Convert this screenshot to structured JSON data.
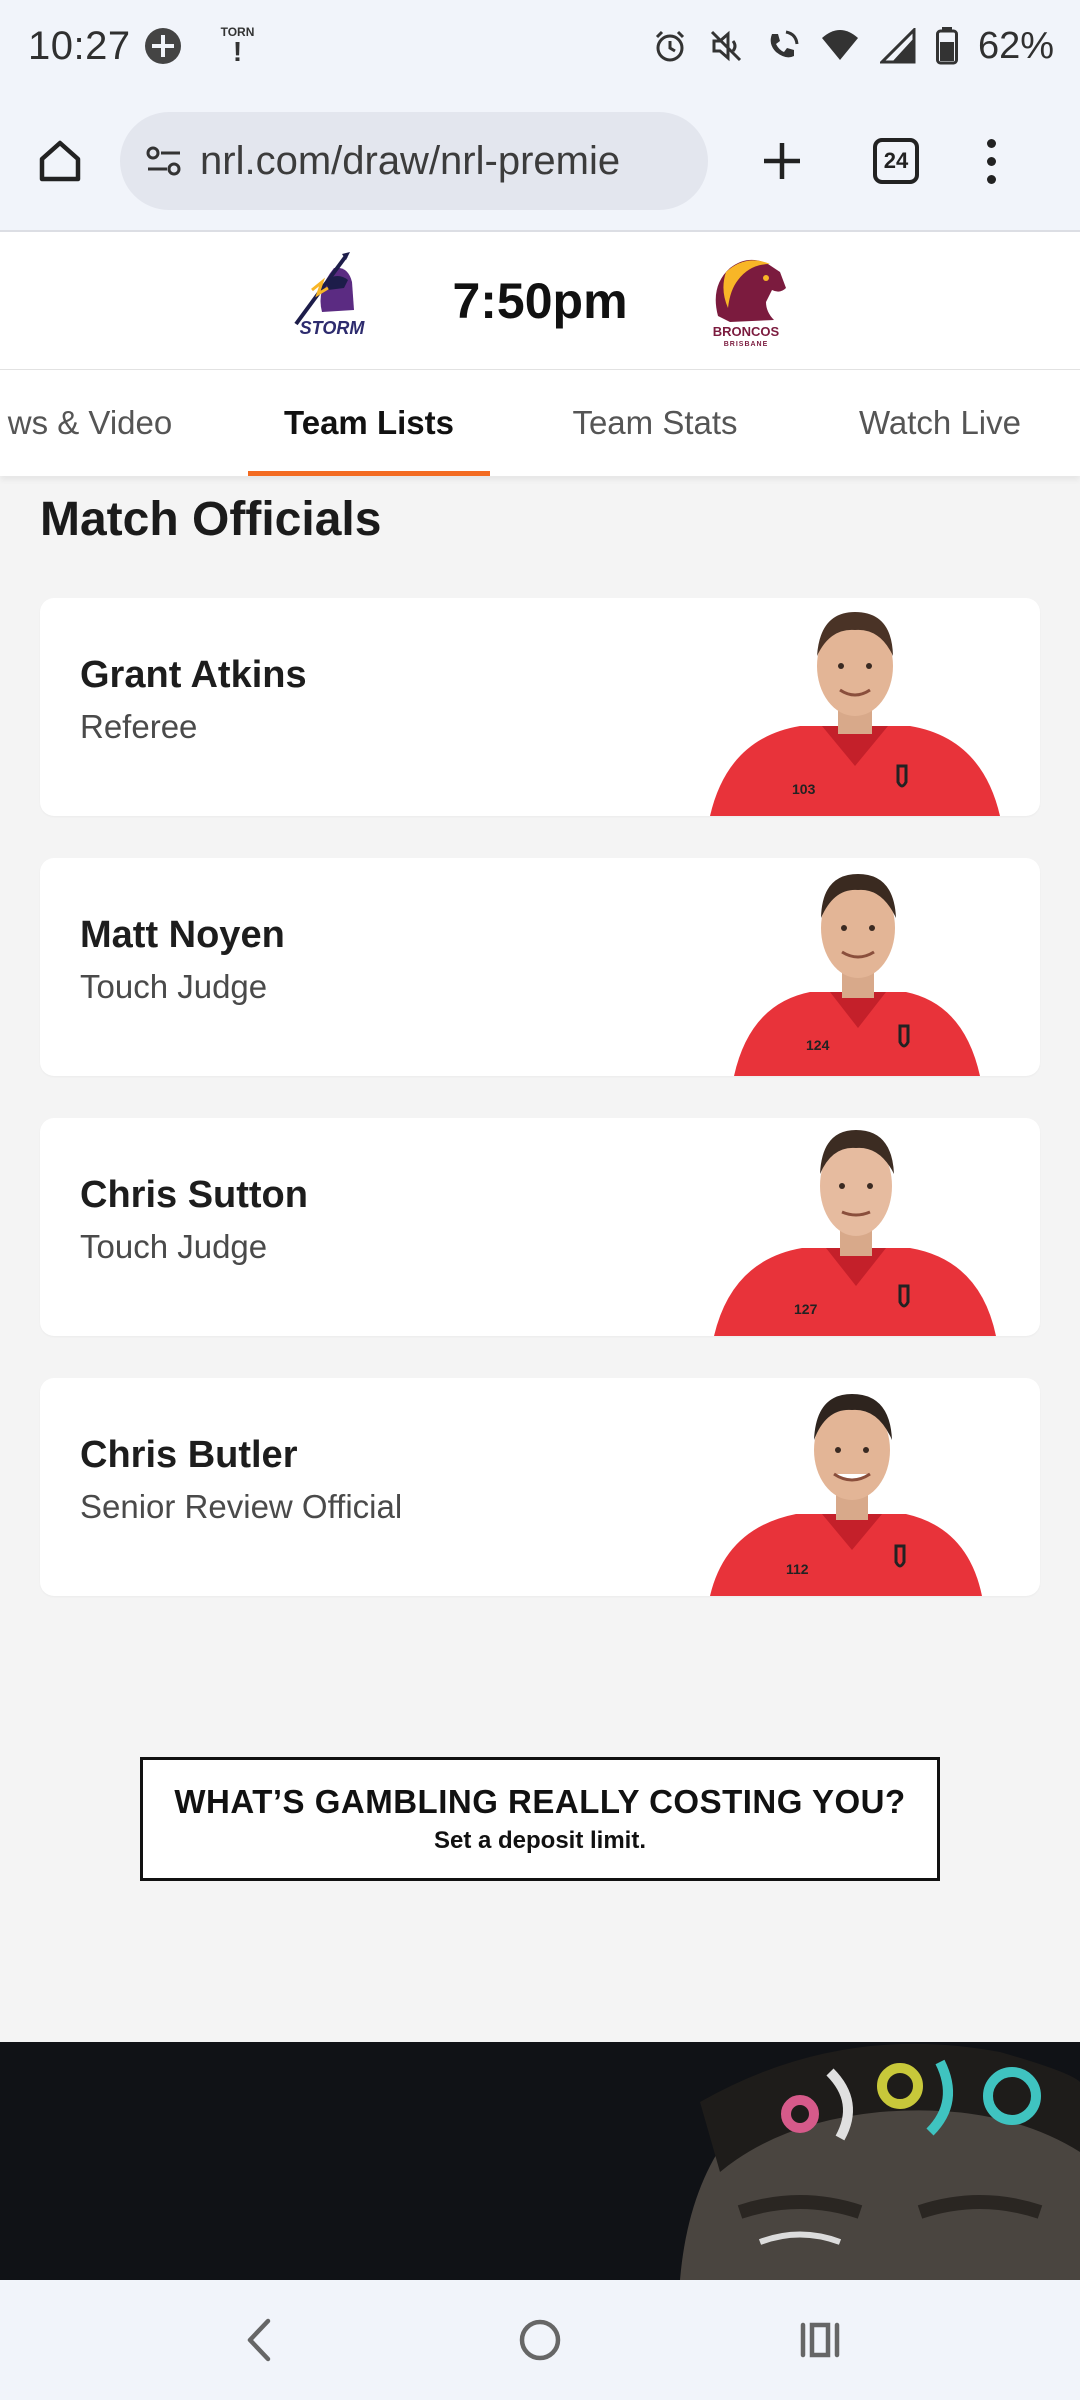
{
  "status_bar": {
    "time": "10:27",
    "notification_badge_top": "TORN",
    "notification_badge_bottom": "!",
    "battery": "62%"
  },
  "browser": {
    "url": "nrl.com/draw/nrl-premie",
    "tab_count": "24"
  },
  "match": {
    "time": "7:50pm",
    "home_team_logo_text": "STORM",
    "away_team_logo_text": "BRONCOS",
    "away_team_logo_subtext": "BRISBANE"
  },
  "tabs": [
    {
      "label": "ws & Video"
    },
    {
      "label": "Team Lists"
    },
    {
      "label": "Team Stats"
    },
    {
      "label": "Watch Live"
    }
  ],
  "section_title": "Match Officials",
  "officials": [
    {
      "name": "Grant Atkins",
      "role": "Referee",
      "number": "103"
    },
    {
      "name": "Matt Noyen",
      "role": "Touch Judge",
      "number": "124"
    },
    {
      "name": "Chris Sutton",
      "role": "Touch Judge",
      "number": "127"
    },
    {
      "name": "Chris Butler",
      "role": "Senior Review Official",
      "number": "112"
    }
  ],
  "gambling_notice": {
    "title": "WHAT’S GAMBLING REALLY COSTING YOU?",
    "subtitle": "Set a deposit limit."
  },
  "colors": {
    "accent": "#f36b21",
    "jersey": "#e8333a",
    "storm_purple": "#5b2b82",
    "broncos_maroon": "#7b1b3e",
    "broncos_gold": "#f8b627"
  }
}
